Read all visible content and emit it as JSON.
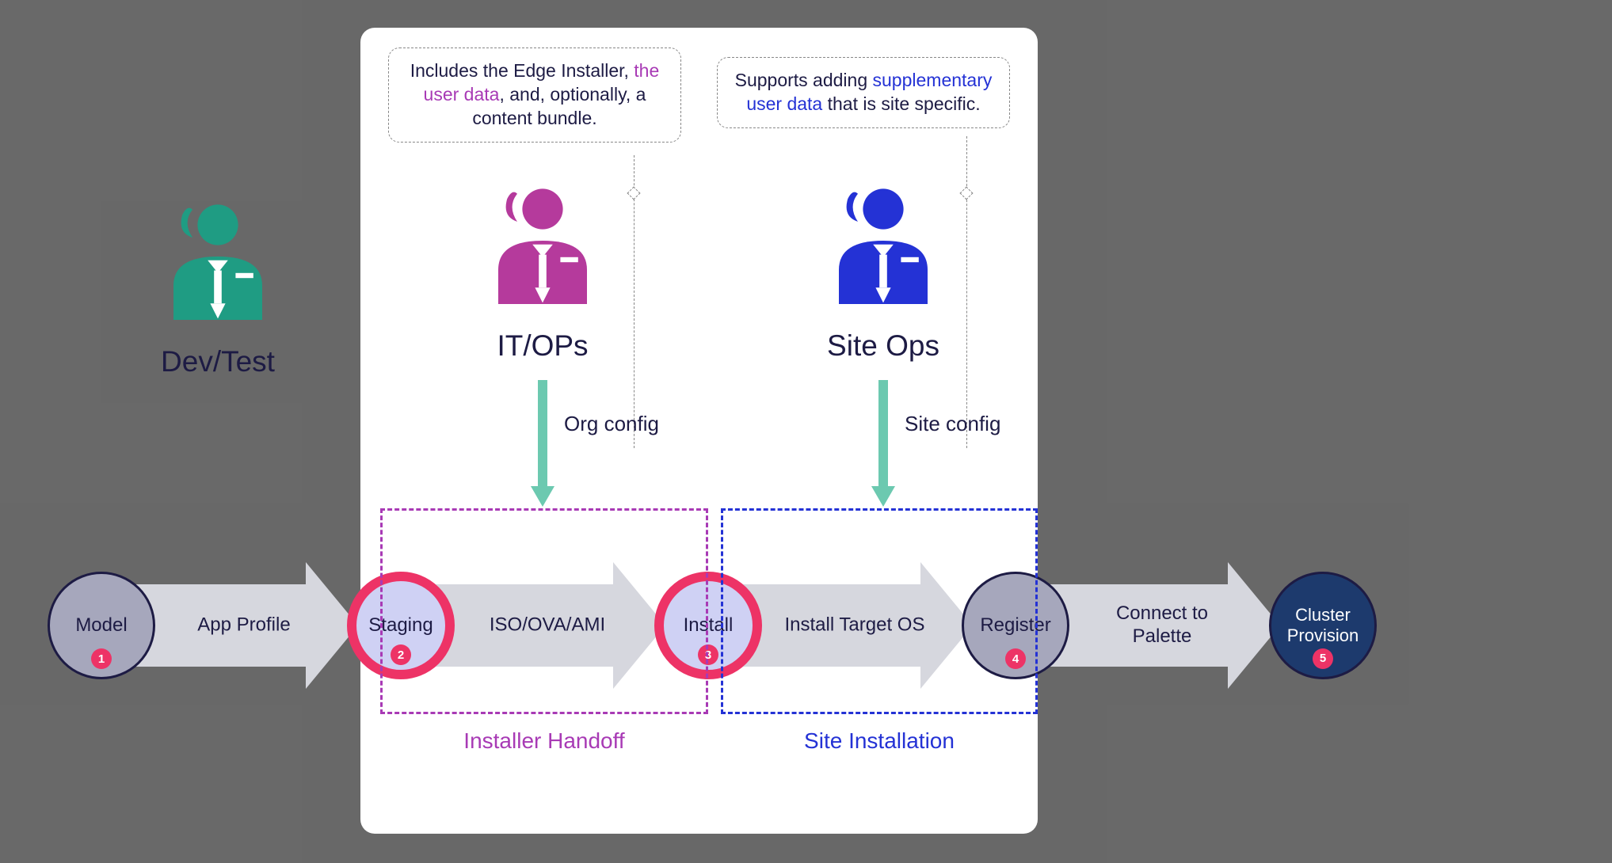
{
  "personas": {
    "devtest": {
      "label": "Dev/Test",
      "color": "#1f9c83"
    },
    "itops": {
      "label": "IT/OPs",
      "color": "#b53a9c"
    },
    "siteops": {
      "label": "Site Ops",
      "color": "#2432d5"
    }
  },
  "bubbles": {
    "itops": {
      "prefix": "Includes the Edge Installer, ",
      "highlight": "the user data",
      "suffix": ", and, optionally, a content bundle."
    },
    "siteops": {
      "prefix": "Supports adding ",
      "highlight": "supplementary user data",
      "suffix": " that is site specific."
    }
  },
  "configs": {
    "org": "Org config",
    "site": "Site config"
  },
  "steps": {
    "model": {
      "label": "Model",
      "num": "1",
      "arrow": "App Profile"
    },
    "staging": {
      "label": "Staging",
      "num": "2",
      "arrow": "ISO/OVA/AMI"
    },
    "install": {
      "label": "Install",
      "num": "3",
      "arrow": "Install Target OS"
    },
    "register": {
      "label": "Register",
      "num": "4",
      "arrow": "Connect to Palette"
    },
    "provision": {
      "label": "Cluster Provision",
      "num": "5"
    }
  },
  "groups": {
    "handoff": {
      "label": "Installer Handoff",
      "color": "#a83ab5"
    },
    "siteinstall": {
      "label": "Site Installation",
      "color": "#2432d5"
    }
  }
}
